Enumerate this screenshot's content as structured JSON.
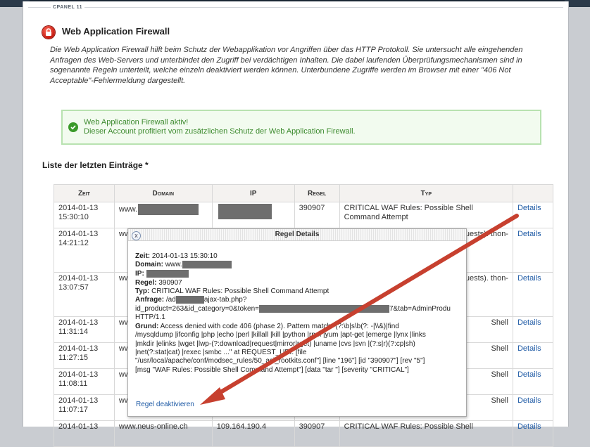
{
  "header": {
    "brand": "CPANEL 11",
    "title": "Web Application Firewall"
  },
  "description": "Die Web Application Firewall hilft beim Schutz der Webapplikation vor Angriffen über das HTTP Protokoll. Sie untersucht alle eingehenden Anfragen des Web-Servers und unterbindet den Zugriff bei verdächtigen Inhalten. Die dabei laufenden Überprüfungsmechanismen sind in sogenannte Regeln unterteilt, welche einzeln deaktiviert werden können. Unterbundene Zugriffe werden im Browser mit einer \"406 Not Acceptable\"-Fehlermeldung dargestellt.",
  "status": {
    "line1": "Web Application Firewall aktiv!",
    "line2": "Dieser Account profitiert vom zusätzlichen Schutz der Web Application Firewall.",
    "color": "#3c8a2e"
  },
  "list_title": "Liste der letzten Einträge *",
  "table": {
    "headers": [
      "Zeit",
      "Domain",
      "IP",
      "Regel",
      "Typ",
      ""
    ],
    "rows": [
      {
        "date": "2014-01-13",
        "time": "15:30:10",
        "domain": "www.",
        "regel": "390907",
        "typ": "CRITICAL WAF Rules: Possible Shell Command Attempt",
        "link": "Details"
      },
      {
        "date": "2014-01-13",
        "time": "14:21:12",
        "domain": "ww",
        "regel": "",
        "typ": "ous requests). thon-",
        "link": "Details"
      },
      {
        "date": "2014-01-13",
        "time": "13:07:57",
        "domain": "ww",
        "regel": "",
        "typ": "ous requests). thon-",
        "link": "Details"
      },
      {
        "date": "2014-01-13",
        "time": "11:31:14",
        "domain": "ww",
        "regel": "",
        "typ": "Shell",
        "link": "Details"
      },
      {
        "date": "2014-01-13",
        "time": "11:27:15",
        "domain": "ww",
        "regel": "",
        "typ": "Shell",
        "link": "Details"
      },
      {
        "date": "2014-01-13",
        "time": "11:08:11",
        "domain": "ww",
        "regel": "",
        "typ": "Shell",
        "link": "Details"
      },
      {
        "date": "2014-01-13",
        "time": "11:07:17",
        "domain": "ww",
        "regel": "",
        "typ": "Shell",
        "link": "Details"
      },
      {
        "date": "2014-01-13",
        "time": "",
        "domain": "www.neus-online.ch",
        "ip": "109.164.190.4",
        "regel": "390907",
        "typ": "CRITICAL WAF Rules: Possible Shell",
        "link": "Details"
      }
    ]
  },
  "dialog": {
    "title": "Regel Details",
    "close": "x",
    "zeit_label": "Zeit:",
    "zeit": "2014-01-13 15:30:10",
    "domain_label": "Domain:",
    "domain": "www.",
    "ip_label": "IP:",
    "regel_label": "Regel:",
    "regel": "390907",
    "typ_label": "Typ:",
    "typ": "CRITICAL WAF Rules: Possible Shell Command Attempt",
    "anfrage_label": "Anfrage:",
    "anfrage_a": "/ad",
    "anfrage_b": "ajax-tab.php?",
    "anfrage_2a": "id_product=263&id_category=0&token=",
    "anfrage_2b": "7&tab=AdminProdu",
    "anfrage_3": "HTTP/1.1",
    "grund_label": "Grund:",
    "grund_1": "Access denied with code 406 (phase 2). Pattern match \"(?:\\b|s\\b(?: -|\\\\&)|find",
    "grund_2": "/mysqldump |ifconfig |php |echo |perl |killall |kill |python |rpm |yum |apt-get |emerge |lynx |links",
    "grund_3": "|mkdir |elinks |wget |lwp-(?:download|request|mirror|rget) |uname |cvs |svn |(?:s|r)(?:cp|sh)",
    "grund_4": "|net(?:stat|cat) |rexec |smbc ...\" at REQUEST_URI. [file",
    "grund_5": "\"/usr/local/apache/conf/modsec_rules/50_asl_rootkits.conf\"] [line \"196\"] [id \"390907\"] [rev \"5\"]",
    "grund_6": "[msg \"WAF Rules: Possible Shell Command Attempt\"] [data \"tar \"] [severity \"CRITICAL\"]",
    "deactivate": "Regel deaktivieren"
  },
  "colors": {
    "link": "#1e5aa5",
    "arrow": "#c7402f",
    "success_border": "#b8e2b0"
  }
}
